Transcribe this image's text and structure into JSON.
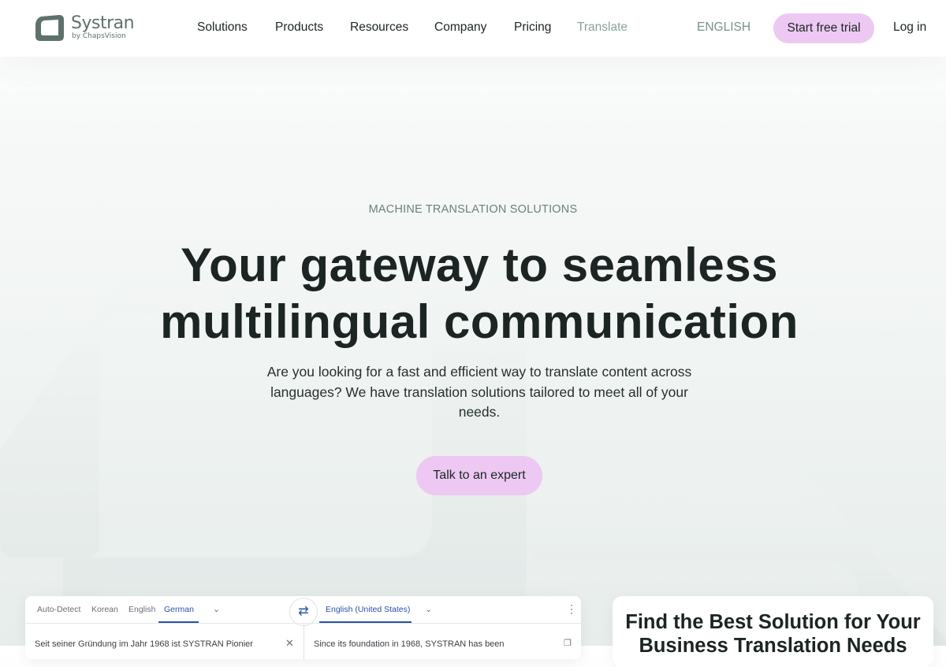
{
  "brand": {
    "name": "Systran",
    "sub": "by ChapsVision"
  },
  "nav": {
    "items": [
      "Solutions",
      "Products",
      "Resources",
      "Company",
      "Pricing",
      "Translate"
    ],
    "language": "ENGLISH",
    "trial_label": "Start free trial",
    "login_label": "Log in"
  },
  "hero": {
    "eyebrow": "MACHINE TRANSLATION SOLUTIONS",
    "title_line1": "Your gateway to seamless",
    "title_line2": "multilingual communication",
    "subtitle": "Are you looking for a fast and efficient way to translate content across languages? We have translation solutions tailored to meet all of your needs.",
    "cta_label": "Talk to an expert"
  },
  "translator": {
    "source_langs": [
      "Auto-Detect",
      "Korean",
      "English",
      "German"
    ],
    "source_active": "German",
    "target_lang": "English (United States)",
    "source_text": "Seit seiner Gründung im Jahr 1968 ist SYSTRAN Pionier",
    "target_text": "Since its foundation in 1968, SYSTRAN has been"
  },
  "solution": {
    "title": "Find the Best Solution for Your Business Translation Needs"
  },
  "colors": {
    "accent_pink": "#ecc8f2",
    "brand_gray": "#5e716d",
    "translator_blue": "#2a52a8"
  },
  "icons": [
    "logo-mark-icon",
    "chevron-down-icon",
    "swap-icon",
    "more-vertical-icon",
    "close-icon",
    "copy-icon"
  ]
}
